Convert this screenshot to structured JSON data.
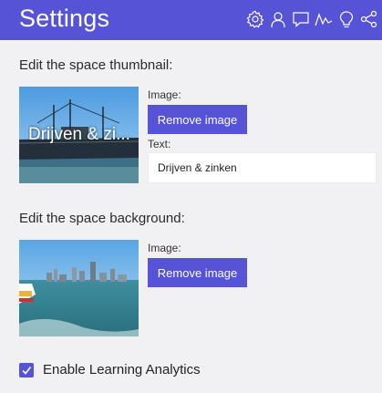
{
  "header": {
    "title": "Settings",
    "icons": [
      "gear-icon",
      "user-icon",
      "chat-icon",
      "analytics-icon",
      "lightbulb-icon",
      "share-icon"
    ]
  },
  "thumbnail": {
    "section_label": "Edit the space thumbnail:",
    "image_label": "Image:",
    "remove_button": "Remove image",
    "text_label": "Text:",
    "text_value": "Drijven & zinken",
    "caption": "Drijven & zi..."
  },
  "background": {
    "section_label": "Edit the space background:",
    "image_label": "Image:",
    "remove_button": "Remove image"
  },
  "analytics": {
    "label": "Enable Learning Analytics",
    "checked": true
  },
  "colors": {
    "accent": "#5653d6",
    "page_background": "#f1f1f3"
  }
}
